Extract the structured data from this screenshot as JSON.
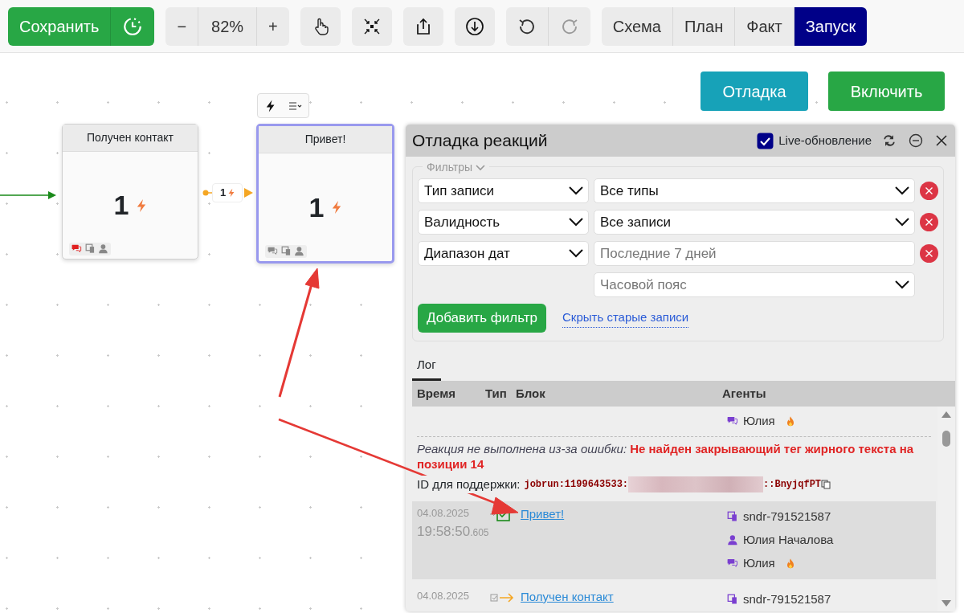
{
  "toolbar": {
    "save": "Сохранить",
    "zoom_out": "−",
    "zoom": "82%",
    "zoom_in": "+",
    "redo_disabled": true,
    "modes": [
      {
        "label": "Схема",
        "selected": false
      },
      {
        "label": "План",
        "selected": false
      },
      {
        "label": "Факт",
        "selected": false
      },
      {
        "label": "Запуск",
        "selected": true
      }
    ]
  },
  "nodes": [
    {
      "title": "Получен контакт",
      "count": "1",
      "selected": false,
      "alert": true
    },
    {
      "title": "Привет!",
      "count": "1",
      "selected": true,
      "alert": false
    }
  ],
  "edge": {
    "count": "1"
  },
  "actions": [
    {
      "label": "Отладка",
      "kind": "info"
    },
    {
      "label": "Включить",
      "kind": "success"
    }
  ],
  "debug_panel": {
    "title": "Отладка реакций",
    "live_update": {
      "label": "Live-обновление",
      "checked": true
    },
    "filters_legend": "Фильтры",
    "filters": [
      {
        "kind": "select",
        "field": "Тип записи",
        "value": "Все типы"
      },
      {
        "kind": "select",
        "field": "Валидность",
        "value": "Все записи"
      },
      {
        "kind": "text",
        "field": "Диапазон дат",
        "placeholder": "Последние 7 дней"
      },
      {
        "kind": "extra",
        "placeholder": "Часовой пояс"
      }
    ],
    "add_filter": "Добавить фильтр",
    "hide_old": "Скрыть старые записи",
    "tabs": [
      {
        "label": "Лог",
        "selected": true
      }
    ],
    "columns": [
      "Время",
      "Тип",
      "Блок",
      "Агенты"
    ],
    "entries": [
      {
        "kind": "error",
        "agents": [
          {
            "kind": "chat",
            "name": "Юлия",
            "hot": true
          }
        ],
        "error": "*Реакция не выполнена из-за ошибки:* **Не найден закрывающий тег жирного текста на позиции 14**",
        "support_label": "ID для поддержки:",
        "id_start": "jobrun:1199643533:",
        "id_end": "::BnyjqfPT"
      },
      {
        "kind": "row",
        "selected": true,
        "type": {
          "kind": "check"
        },
        "date": "04.08.2025",
        "time": "19:58:50",
        "ms": ".605",
        "block": "Привет!",
        "agents": [
          {
            "kind": "sender",
            "name": "sndr-791521587",
            "hot": false
          },
          {
            "kind": "person",
            "name": "Юлия Началова",
            "hot": false
          },
          {
            "kind": "chat",
            "name": "Юлия",
            "hot": true
          }
        ]
      },
      {
        "kind": "row",
        "selected": false,
        "type": {
          "kind": "start"
        },
        "date": "04.08.2025",
        "block": "Получен контакт",
        "agents": [
          {
            "kind": "sender",
            "name": "sndr-791521587",
            "hot": false
          }
        ]
      }
    ]
  }
}
